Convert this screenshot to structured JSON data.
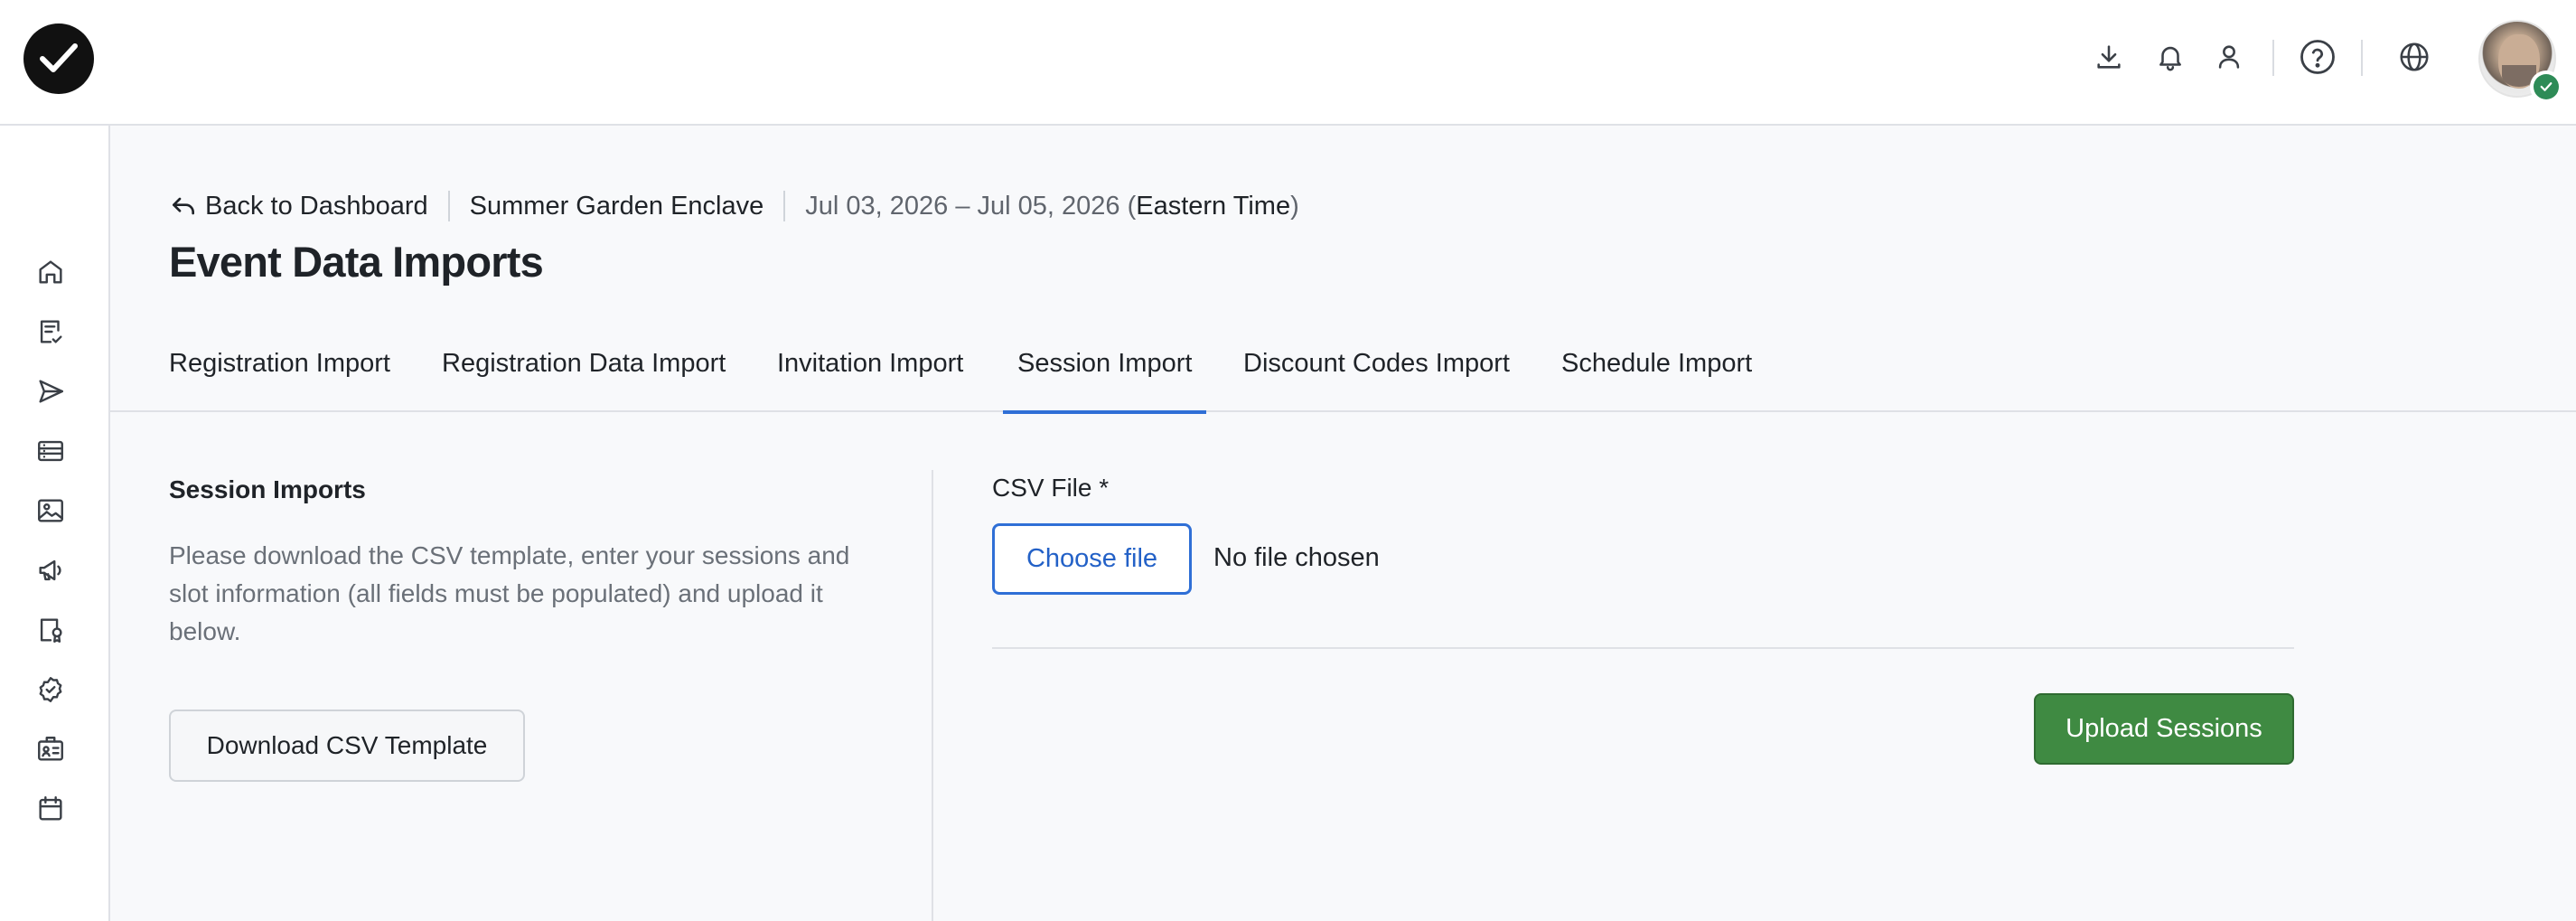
{
  "header": {
    "icons": [
      "download-icon",
      "bell-icon",
      "user-icon",
      "help-icon",
      "globe-icon"
    ],
    "avatar": "avatar",
    "accent_color": "#2f6fd6"
  },
  "sidebar": {
    "icons": [
      "home-icon",
      "checklist-icon",
      "send-icon",
      "list-icon",
      "image-icon",
      "megaphone-icon",
      "badge-certificate-icon",
      "check-circle-icon",
      "id-badge-icon",
      "calendar-icon"
    ]
  },
  "breadcrumb": {
    "back_label": "Back to Dashboard",
    "event_name": "Summer Garden Enclave",
    "date_range": "Jul 03, 2026 – Jul 05, 2026 (",
    "timezone": "Eastern Time",
    "close_paren": ")"
  },
  "page": {
    "title": "Event Data Imports"
  },
  "tabs": [
    {
      "label": "Registration Import",
      "active": false
    },
    {
      "label": "Registration Data Import",
      "active": false
    },
    {
      "label": "Invitation Import",
      "active": false
    },
    {
      "label": "Session Import",
      "active": true
    },
    {
      "label": "Discount Codes Import",
      "active": false
    },
    {
      "label": "Schedule Import",
      "active": false
    }
  ],
  "session_imports": {
    "title": "Session Imports",
    "description_lines": [
      "Please download the CSV template, enter your sessions and",
      "slot information (all fields must be populated) and upload it",
      "below."
    ],
    "download_label": "Download CSV Template"
  },
  "upload": {
    "csv_label": "CSV File *",
    "choose_label": "Choose file",
    "file_status": "No file chosen",
    "upload_label": "Upload Sessions",
    "upload_color": "#3f8a42"
  }
}
